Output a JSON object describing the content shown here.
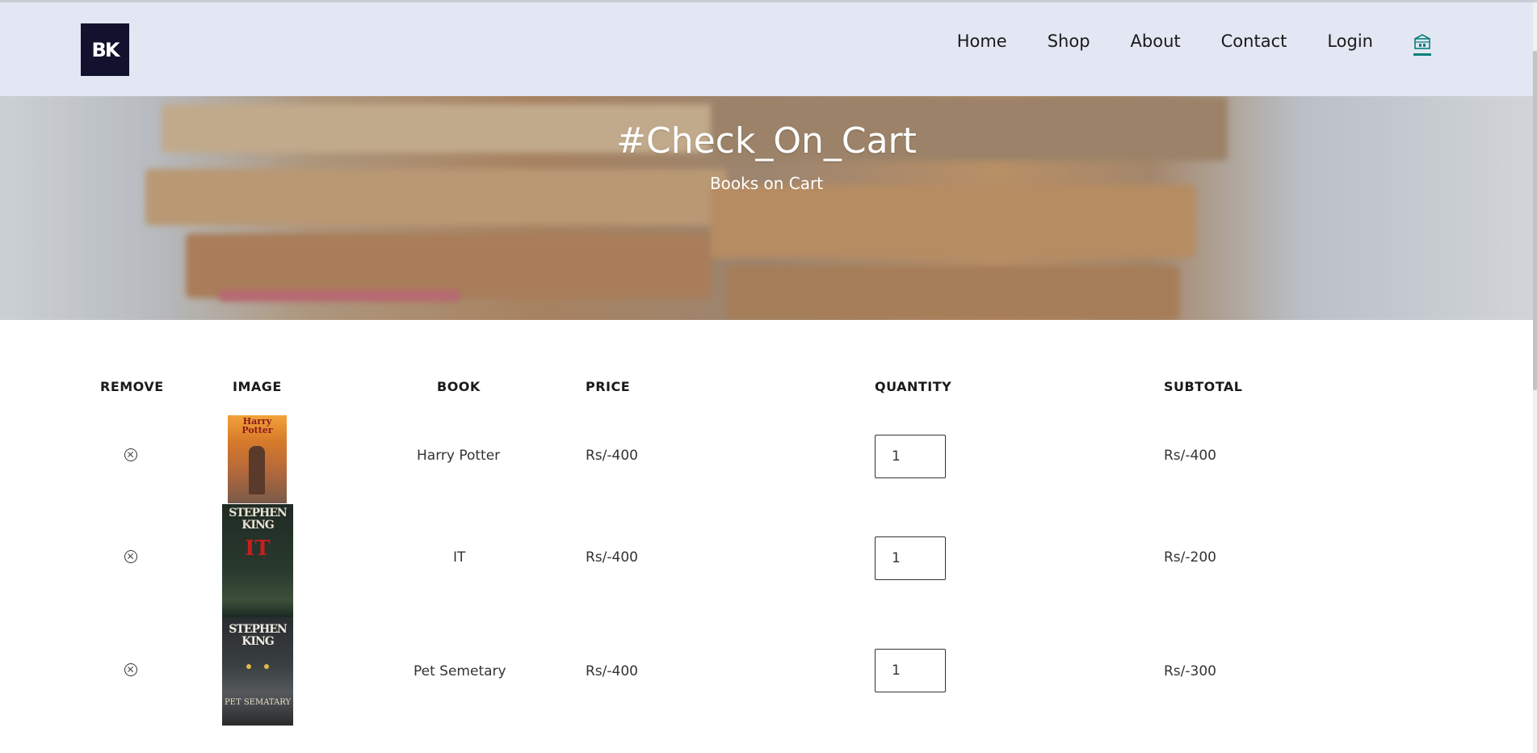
{
  "brand": {
    "logo_text": "BK"
  },
  "nav": {
    "items": [
      {
        "label": "Home"
      },
      {
        "label": "Shop"
      },
      {
        "label": "About"
      },
      {
        "label": "Contact"
      },
      {
        "label": "Login"
      }
    ],
    "cart_icon": "bag-icon",
    "accent_color": "#088178"
  },
  "hero": {
    "title": "#Check_On_Cart",
    "subtitle": "Books on Cart"
  },
  "table": {
    "headers": {
      "remove": "REMOVE",
      "image": "IMAGE",
      "book": "BOOK",
      "price": "PRICE",
      "quantity": "QUANTITY",
      "subtotal": "SUBTOTAL"
    },
    "rows": [
      {
        "book": "Harry Potter",
        "price": "Rs/-400",
        "quantity": "1",
        "subtotal": "Rs/-400",
        "cover_title": "Harry Potter"
      },
      {
        "book": "IT",
        "price": "Rs/-400",
        "quantity": "1",
        "subtotal": "Rs/-200",
        "cover_author": "STEPHEN KING",
        "cover_title": "IT"
      },
      {
        "book": "Pet Semetary",
        "price": "Rs/-400",
        "quantity": "1",
        "subtotal": "Rs/-300",
        "cover_author": "STEPHEN KING",
        "cover_title": "PET SEMATARY"
      }
    ]
  }
}
